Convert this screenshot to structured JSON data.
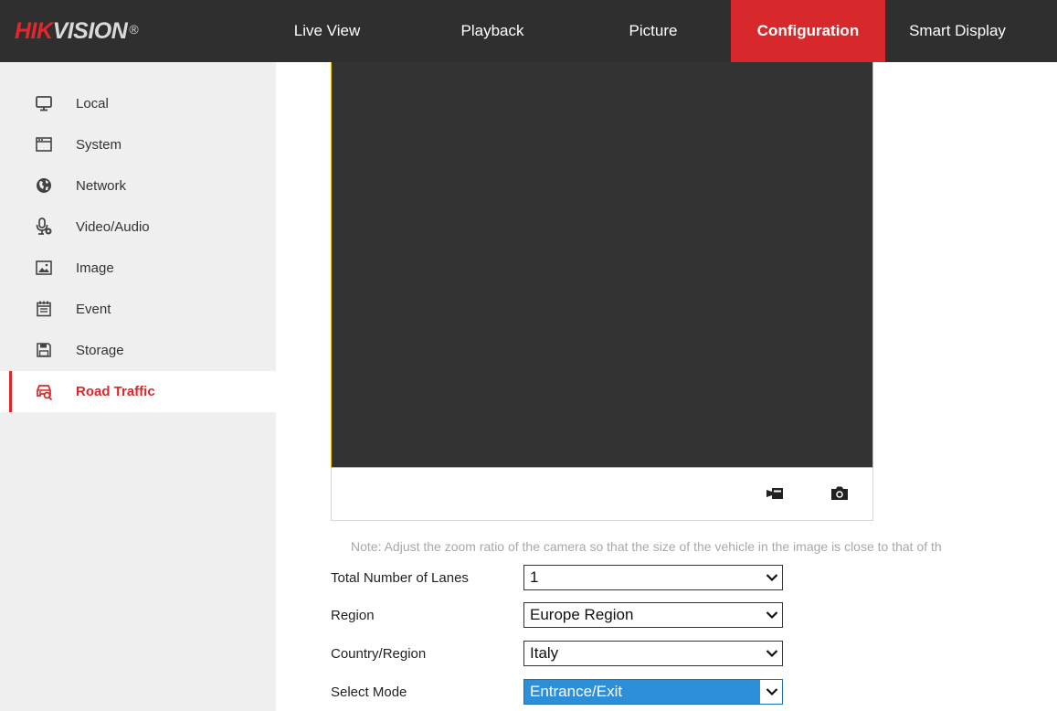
{
  "header": {
    "logo_hik": "HIK",
    "logo_vision": "VISION",
    "logo_reg": "®",
    "nav": [
      {
        "label": "Live View"
      },
      {
        "label": "Playback"
      },
      {
        "label": "Picture"
      },
      {
        "label": "Configuration",
        "active": true
      },
      {
        "label": "Smart Display"
      }
    ]
  },
  "sidebar": {
    "items": [
      {
        "label": "Local",
        "icon": "monitor-icon"
      },
      {
        "label": "System",
        "icon": "system-window-icon"
      },
      {
        "label": "Network",
        "icon": "globe-icon"
      },
      {
        "label": "Video/Audio",
        "icon": "microphone-icon"
      },
      {
        "label": "Image",
        "icon": "image-icon"
      },
      {
        "label": "Event",
        "icon": "calendar-icon"
      },
      {
        "label": "Storage",
        "icon": "floppy-disk-icon"
      },
      {
        "label": "Road Traffic",
        "icon": "vehicle-search-icon",
        "active": true
      }
    ]
  },
  "video_toolbar": {
    "record_icon": "record-video-icon",
    "capture_icon": "camera-capture-icon"
  },
  "form": {
    "note": "Note: Adjust the zoom ratio of the camera so that the size of the vehicle in the image is close to that of th",
    "fields": [
      {
        "label": "Total Number of Lanes",
        "value": "1"
      },
      {
        "label": "Region",
        "value": "Europe Region"
      },
      {
        "label": "Country/Region",
        "value": "Italy"
      },
      {
        "label": "Select Mode",
        "value": "Entrance/Exit",
        "highlighted": true
      }
    ]
  },
  "colors": {
    "header_bg": "#2f2f2f",
    "accent_red": "#d7292b",
    "sidebar_bg": "#efefef",
    "video_bg": "#333333",
    "video_border": "#e5c100",
    "select_highlight": "#2d8fd8"
  }
}
